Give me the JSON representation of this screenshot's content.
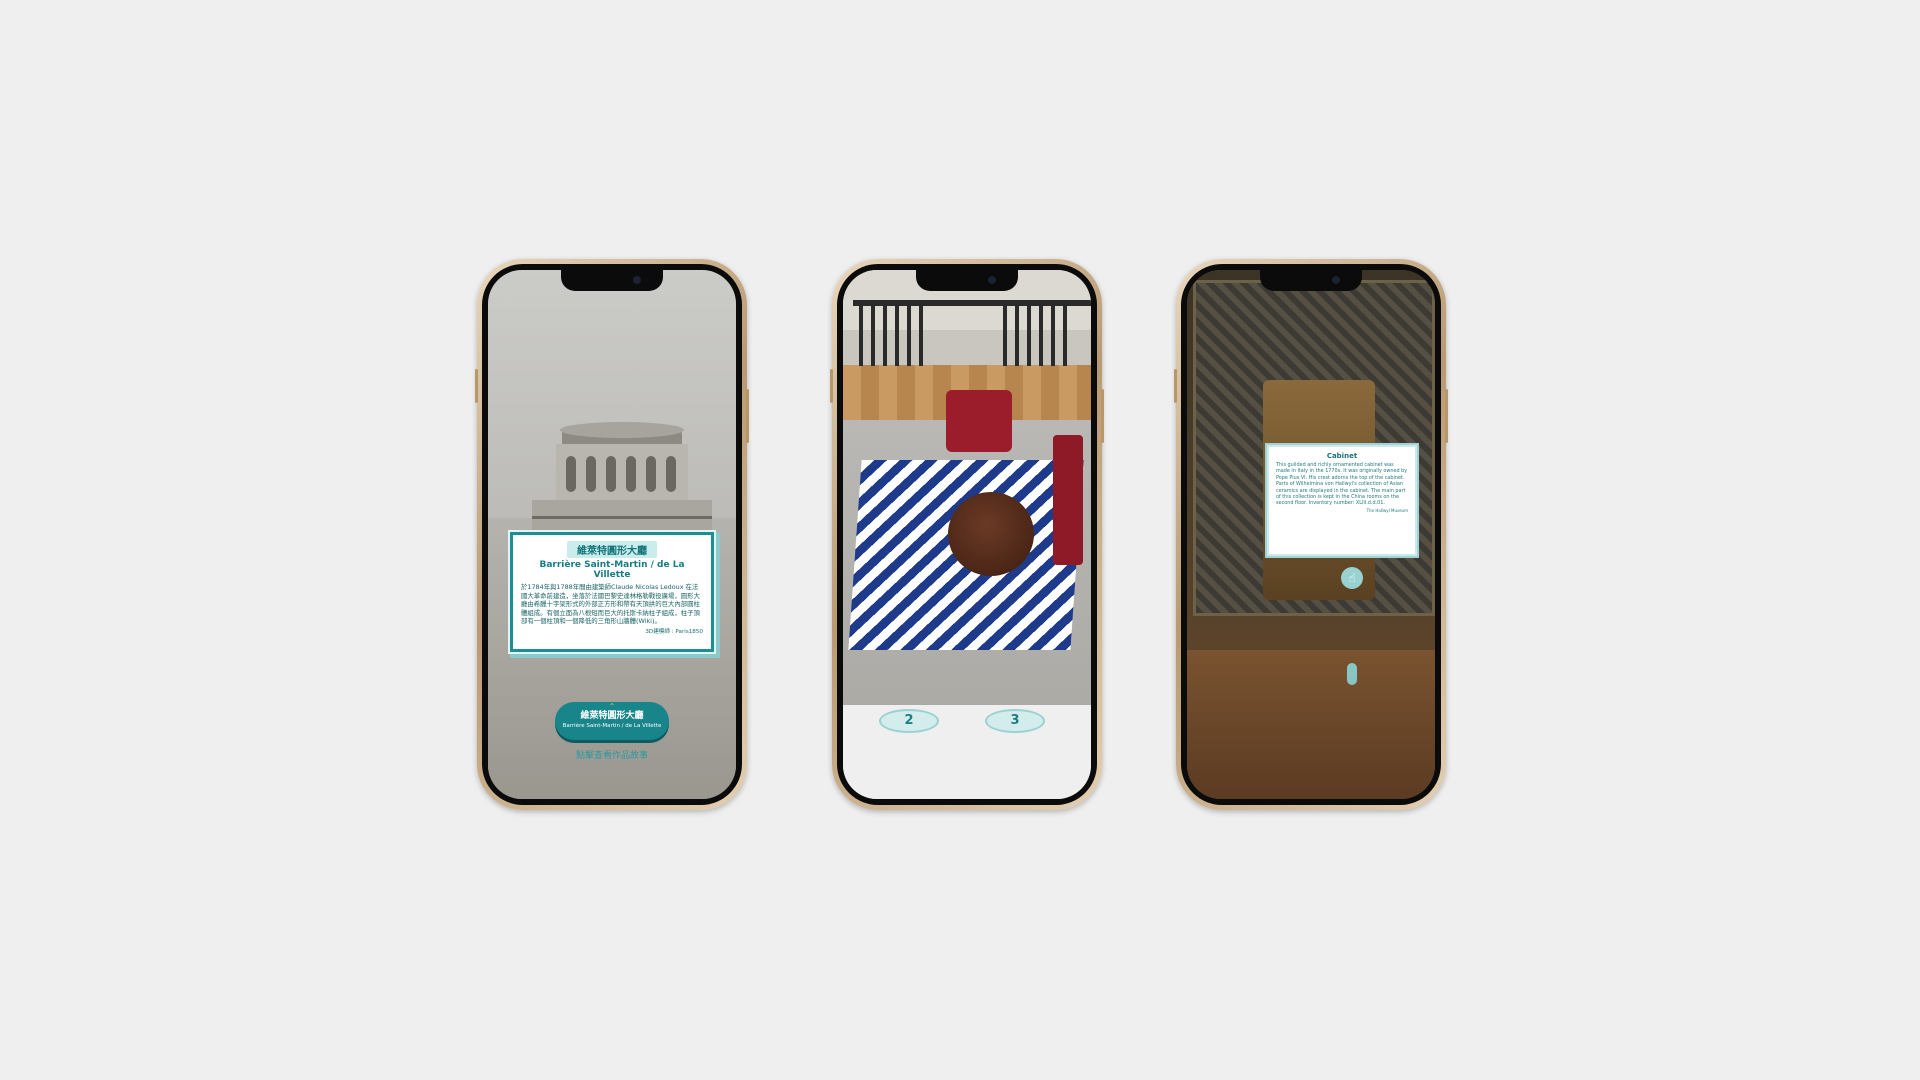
{
  "phones": [
    {
      "card": {
        "title_cn": "維萊特圓形大廳",
        "title_fr": "Barrière Saint-Martin / de La Villette",
        "body": "於1784年與1788年間由建築師Claude Nicolas Ledoux 在法國大革命前建造，坐落於法國巴黎史達林格勒戰役廣場，圓形大廳由希臘十字架形式的外部正方形和帶有天頂拱的巨大內部圓柱體組成。有個立面為八根短而巨大的托斯卡納柱子組成，柱子頂部有一個柱頂和一個降低的三角形山牆體(Wiki)。",
        "credit": "3D建模師 : Paris1850"
      },
      "pill": {
        "chevron": "⌃",
        "title_cn": "維萊特圓形大廳",
        "title_fr": "Barrière Saint-Martin / de La Villette"
      },
      "hint": "點擊查看作品故事"
    },
    {
      "buttons": [
        "2",
        "3"
      ]
    },
    {
      "card": {
        "title": "Cabinet",
        "body": "This guilded and richly ornamented cabinet was made in Italy in the 1770s. It was originally owned by Pope Pius VI. His crest adorns the top of the cabinet. Parts of Wilhelmina von Hallwyl's collection of Asian ceramics are displayed in the cabinet. The main part of this collection is kept in the China rooms on the second floor. Inventory number: XLIII.d.d.01.",
        "credit": "The Hallwyl Museum"
      },
      "hand_icon": "hand-pointer-icon"
    }
  ],
  "colors": {
    "accent": "#17858a",
    "page_bg": "#efefef"
  }
}
